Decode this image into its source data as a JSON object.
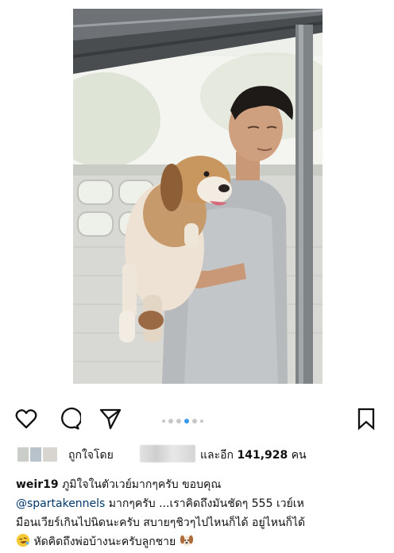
{
  "post": {
    "liked_by_prefix": "ถูกใจโดย",
    "liked_by_suffix": "และอีก",
    "likes_count": "141,928",
    "likes_unit": "คน",
    "carousel": {
      "total": 6,
      "active_index": 3
    }
  },
  "caption": {
    "username": "weir19",
    "line1_text": "ภูมิใจในตัวเวย์มากๆครับ ขอบคุณ",
    "mention": "@spartakennels",
    "line2_text": " มากๆครับ ...เราคิดถึงมันชัดๆ 555 เวย์เห",
    "line3_text": "มือนเวียร์เกินไปนิดนะครับ สบายๆชิวๆไปไหนก็ได้ อยู่ไหนก็ได้",
    "line4_text": "หัดคิดถึงพ่อบ้างนะครับลูกชาย"
  },
  "icons": {
    "like": "heart-outline-icon",
    "comment": "comment-bubble-icon",
    "share": "paper-plane-icon",
    "save": "bookmark-icon"
  },
  "colors": {
    "text": "#111111",
    "mention": "#00376b",
    "dot_active": "#3897f0",
    "dot_inactive": "#c7c7c7"
  }
}
